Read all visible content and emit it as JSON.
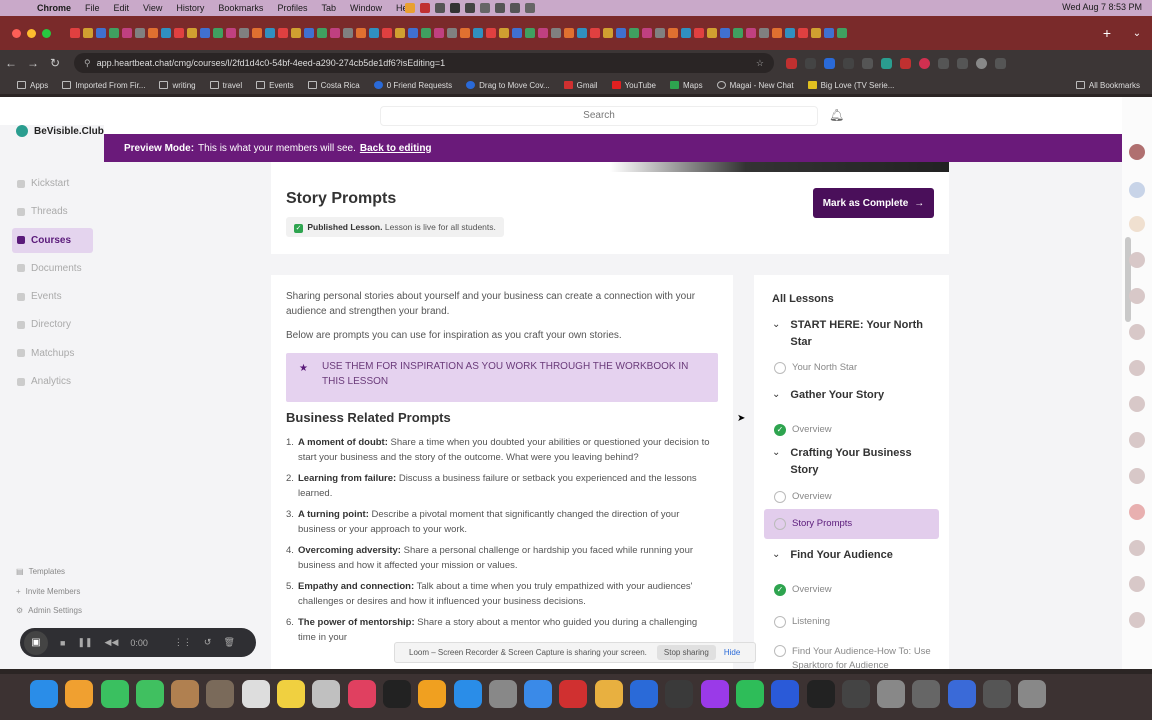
{
  "menubar": {
    "app": "Chrome",
    "items": [
      "File",
      "Edit",
      "View",
      "History",
      "Bookmarks",
      "Profiles",
      "Tab",
      "Window",
      "Help"
    ],
    "clock": "Wed Aug 7  8:53 PM"
  },
  "browser": {
    "url": "app.heartbeat.chat/cmg/courses/l/2fd1d4c0-54bf-4eed-a290-274cb5de1df6?isEditing=1",
    "bookmarks": [
      "Apps",
      "Imported From Fir...",
      "writing",
      "travel",
      "Events",
      "Costa Rica",
      "0 Friend Requests",
      "Drag to Move Cov...",
      "Gmail",
      "YouTube",
      "Maps",
      "Magai - New Chat",
      "Big Love (TV Serie..."
    ],
    "all_bookmarks": "All Bookmarks"
  },
  "topbar": {
    "search_placeholder": "Search"
  },
  "preview": {
    "label": "Preview Mode:",
    "text": "This is what your members will see.",
    "link": "Back to editing"
  },
  "sidebar": {
    "brand": "BeVisible.Club",
    "nav": [
      "Kickstart",
      "Threads",
      "Courses",
      "Documents",
      "Events",
      "Directory",
      "Matchups",
      "Analytics"
    ],
    "admin": [
      "Templates",
      "Invite Members",
      "Admin Settings"
    ]
  },
  "lesson": {
    "title": "Story Prompts",
    "published_label": "Published Lesson.",
    "published_text": "Lesson is live for all students.",
    "complete_button": "Mark as Complete",
    "intro1": "Sharing personal stories about yourself and your business can create a connection with your audience and strengthen your brand.",
    "intro2": "Below are prompts you can use for inspiration as you craft your own stories.",
    "callout": "USE THEM FOR INSPIRATION AS YOU WORK THROUGH THE WORKBOOK IN THIS LESSON",
    "section_heading": "Business Related Prompts",
    "prompts": [
      {
        "num": "1.",
        "title": "A moment of doubt:",
        "text": " Share a time when you doubted your abilities or questioned your decision to start your business and the story of the outcome. What were you leaving behind?"
      },
      {
        "num": "2.",
        "title": "Learning from failure:",
        "text": " Discuss a business failure or setback you experienced and the lessons learned."
      },
      {
        "num": "3.",
        "title": "A turning point:",
        "text": " Describe a pivotal moment that significantly changed the direction of your business or your approach to your work."
      },
      {
        "num": "4.",
        "title": "Overcoming adversity:",
        "text": " Share a personal challenge or hardship you faced while running your business and how it affected your mission or values."
      },
      {
        "num": "5.",
        "title": "Empathy and connection:",
        "text": " Talk about a time when you truly empathized with your audiences' challenges or desires and how it influenced your business decisions."
      },
      {
        "num": "6.",
        "title": "The power of mentorship:",
        "text": " Share a story about a mentor who guided you during a challenging time in your"
      }
    ]
  },
  "all_lessons": {
    "title": "All Lessons",
    "module1": "START HERE: Your North Star",
    "lesson_north_star": "Your North Star",
    "module2": "Gather Your Story",
    "lesson_overview_a": "Overview",
    "module3": "Crafting Your Business Story",
    "lesson_overview_b": "Overview",
    "lesson_story_prompts": "Story Prompts",
    "module4": "Find Your Audience",
    "lesson_overview_c": "Overview",
    "lesson_listening": "Listening",
    "lesson_find_audience": "Find Your Audience-How To: Use Sparktoro for Audience"
  },
  "loom": {
    "timer": "0:00",
    "share_text": "Loom – Screen Recorder & Screen Capture is sharing your screen.",
    "stop": "Stop sharing",
    "hide": "Hide"
  },
  "colors": {
    "brand_purple": "#4a0f5a",
    "preview_bar": "#6a1a7a",
    "active_nav": "#e4d4ee",
    "complete_green": "#2ea44f"
  }
}
